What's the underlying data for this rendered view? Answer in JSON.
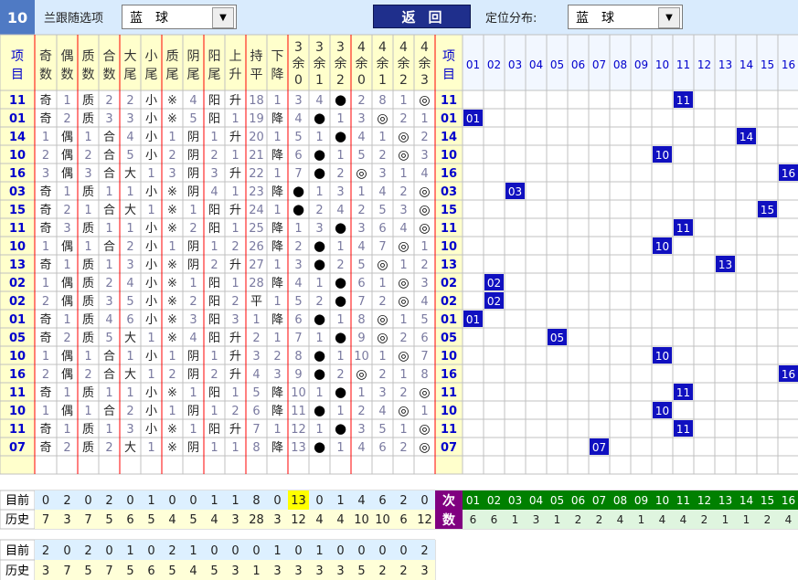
{
  "header": {
    "issue_no": "10",
    "filter_label": "兰跟随选项",
    "filter_value": "蓝　球",
    "back_label": "返回",
    "position_label": "定位分布:",
    "position_value": "蓝　球"
  },
  "columns": {
    "left": [
      "项目",
      "奇数",
      "偶数",
      "质数",
      "合数",
      "大尾",
      "小尾",
      "质尾",
      "阴尾",
      "阳尾",
      "上升",
      "持平",
      "下降",
      "3余0",
      "3余1",
      "3余2",
      "4余0",
      "4余1",
      "4余2",
      "4余3",
      "项目"
    ],
    "dist": [
      "01",
      "02",
      "03",
      "04",
      "05",
      "06",
      "07",
      "08",
      "09",
      "10",
      "11",
      "12",
      "13",
      "14",
      "15",
      "16"
    ]
  },
  "rows": [
    {
      "n": "11",
      "c": [
        "奇",
        "1",
        "质",
        "2",
        "2",
        "小",
        "※",
        "4",
        "阳",
        "升",
        "18",
        "1",
        "3",
        "4",
        "●",
        "2",
        "8",
        "1",
        "◎"
      ]
    },
    {
      "n": "01",
      "c": [
        "奇",
        "2",
        "质",
        "3",
        "3",
        "小",
        "※",
        "5",
        "阳",
        "1",
        "19",
        "降",
        "4",
        "●",
        "1",
        "3",
        "◎",
        "2",
        "1"
      ]
    },
    {
      "n": "14",
      "c": [
        "1",
        "偶",
        "1",
        "合",
        "4",
        "小",
        "1",
        "阴",
        "1",
        "升",
        "20",
        "1",
        "5",
        "1",
        "●",
        "4",
        "1",
        "◎",
        "2"
      ]
    },
    {
      "n": "10",
      "c": [
        "2",
        "偶",
        "2",
        "合",
        "5",
        "小",
        "2",
        "阴",
        "2",
        "1",
        "21",
        "降",
        "6",
        "●",
        "1",
        "5",
        "2",
        "◎",
        "3"
      ]
    },
    {
      "n": "16",
      "c": [
        "3",
        "偶",
        "3",
        "合",
        "大",
        "1",
        "3",
        "阴",
        "3",
        "升",
        "22",
        "1",
        "7",
        "●",
        "2",
        "◎",
        "3",
        "1",
        "4"
      ]
    },
    {
      "n": "03",
      "c": [
        "奇",
        "1",
        "质",
        "1",
        "1",
        "小",
        "※",
        "阴",
        "4",
        "1",
        "23",
        "降",
        "●",
        "1",
        "3",
        "1",
        "4",
        "2",
        "◎"
      ]
    },
    {
      "n": "15",
      "c": [
        "奇",
        "2",
        "1",
        "合",
        "大",
        "1",
        "※",
        "1",
        "阳",
        "升",
        "24",
        "1",
        "●",
        "2",
        "4",
        "2",
        "5",
        "3",
        "◎"
      ]
    },
    {
      "n": "11",
      "c": [
        "奇",
        "3",
        "质",
        "1",
        "1",
        "小",
        "※",
        "2",
        "阳",
        "1",
        "25",
        "降",
        "1",
        "3",
        "●",
        "3",
        "6",
        "4",
        "◎"
      ]
    },
    {
      "n": "10",
      "c": [
        "1",
        "偶",
        "1",
        "合",
        "2",
        "小",
        "1",
        "阴",
        "1",
        "2",
        "26",
        "降",
        "2",
        "●",
        "1",
        "4",
        "7",
        "◎",
        "1"
      ]
    },
    {
      "n": "13",
      "c": [
        "奇",
        "1",
        "质",
        "1",
        "3",
        "小",
        "※",
        "阴",
        "2",
        "升",
        "27",
        "1",
        "3",
        "●",
        "2",
        "5",
        "◎",
        "1",
        "2"
      ]
    },
    {
      "n": "02",
      "c": [
        "1",
        "偶",
        "质",
        "2",
        "4",
        "小",
        "※",
        "1",
        "阳",
        "1",
        "28",
        "降",
        "4",
        "1",
        "●",
        "6",
        "1",
        "◎",
        "3"
      ]
    },
    {
      "n": "02",
      "c": [
        "2",
        "偶",
        "质",
        "3",
        "5",
        "小",
        "※",
        "2",
        "阳",
        "2",
        "平",
        "1",
        "5",
        "2",
        "●",
        "7",
        "2",
        "◎",
        "4"
      ]
    },
    {
      "n": "01",
      "c": [
        "奇",
        "1",
        "质",
        "4",
        "6",
        "小",
        "※",
        "3",
        "阳",
        "3",
        "1",
        "降",
        "6",
        "●",
        "1",
        "8",
        "◎",
        "1",
        "5"
      ]
    },
    {
      "n": "05",
      "c": [
        "奇",
        "2",
        "质",
        "5",
        "大",
        "1",
        "※",
        "4",
        "阳",
        "升",
        "2",
        "1",
        "7",
        "1",
        "●",
        "9",
        "◎",
        "2",
        "6"
      ]
    },
    {
      "n": "10",
      "c": [
        "1",
        "偶",
        "1",
        "合",
        "1",
        "小",
        "1",
        "阴",
        "1",
        "升",
        "3",
        "2",
        "8",
        "●",
        "1",
        "10",
        "1",
        "◎",
        "7"
      ]
    },
    {
      "n": "16",
      "c": [
        "2",
        "偶",
        "2",
        "合",
        "大",
        "1",
        "2",
        "阴",
        "2",
        "升",
        "4",
        "3",
        "9",
        "●",
        "2",
        "◎",
        "2",
        "1",
        "8"
      ]
    },
    {
      "n": "11",
      "c": [
        "奇",
        "1",
        "质",
        "1",
        "1",
        "小",
        "※",
        "1",
        "阳",
        "1",
        "5",
        "降",
        "10",
        "1",
        "●",
        "1",
        "3",
        "2",
        "◎"
      ]
    },
    {
      "n": "10",
      "c": [
        "1",
        "偶",
        "1",
        "合",
        "2",
        "小",
        "1",
        "阴",
        "1",
        "2",
        "6",
        "降",
        "11",
        "●",
        "1",
        "2",
        "4",
        "◎",
        "1"
      ]
    },
    {
      "n": "11",
      "c": [
        "奇",
        "1",
        "质",
        "1",
        "3",
        "小",
        "※",
        "1",
        "阳",
        "升",
        "7",
        "1",
        "12",
        "1",
        "●",
        "3",
        "5",
        "1",
        "◎"
      ]
    },
    {
      "n": "07",
      "c": [
        "奇",
        "2",
        "质",
        "2",
        "大",
        "1",
        "※",
        "阴",
        "1",
        "1",
        "8",
        "降",
        "13",
        "●",
        "1",
        "4",
        "6",
        "2",
        "◎"
      ]
    }
  ],
  "footer": {
    "current_label": "目前",
    "history_label": "历史",
    "current": [
      "0",
      "2",
      "0",
      "2",
      "0",
      "1",
      "0",
      "0",
      "1",
      "1",
      "8",
      "0",
      "13",
      "0",
      "1",
      "4",
      "6",
      "2",
      "0"
    ],
    "history": [
      "7",
      "3",
      "7",
      "5",
      "6",
      "5",
      "4",
      "5",
      "4",
      "3",
      "28",
      "3",
      "12",
      "4",
      "4",
      "10",
      "10",
      "6",
      "12"
    ],
    "count_label": "次数",
    "dist_counts": [
      "6",
      "6",
      "1",
      "3",
      "1",
      "2",
      "2",
      "4",
      "1",
      "4",
      "4",
      "2",
      "1",
      "1",
      "2",
      "4"
    ]
  },
  "footer2": {
    "current_label": "目前",
    "history_label": "历史",
    "current": [
      "2",
      "0",
      "2",
      "0",
      "1",
      "0",
      "2",
      "1",
      "0",
      "0",
      "0",
      "1",
      "0",
      "1",
      "0",
      "0",
      "0",
      "0",
      "2"
    ],
    "history": [
      "3",
      "7",
      "5",
      "7",
      "5",
      "6",
      "5",
      "4",
      "5",
      "3",
      "1",
      "3",
      "3",
      "3",
      "3",
      "5",
      "2",
      "2",
      "3"
    ]
  },
  "colors": {
    "header_bg": "#ffffcc",
    "grid": "#c0c0c0",
    "red_line": "#ff0000",
    "number_box": "#1010c0",
    "number_text": "#ffffff",
    "item_number": "#0000cc",
    "tan_line": "#c08080",
    "highlight": "#ffff00",
    "count_bg": "#800080",
    "dist_header_green": "#008000"
  }
}
